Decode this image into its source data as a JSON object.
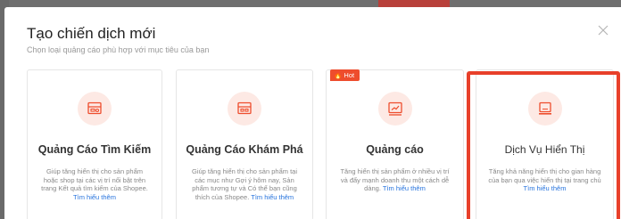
{
  "modal": {
    "title": "Tạo chiến dịch mới",
    "subtitle": "Chọn loại quảng cáo phù hợp với mục tiêu của bạn"
  },
  "cards": [
    {
      "title": "Quảng Cáo Tìm Kiếm",
      "desc": "Giúp tăng hiển thị cho sản phẩm hoặc shop tại các vị trí nổi bật trên trang Kết quả tìm kiếm của Shopee.",
      "learn": "Tìm hiểu thêm",
      "icon": "search-ad-icon"
    },
    {
      "title": "Quảng Cáo Khám Phá",
      "desc": "Giúp tăng hiển thị cho sản phẩm tại các mục như Gợi ý hôm nay, Sản phẩm tương tự và Có thể bạn cũng thích của Shopee.",
      "learn": "Tìm hiểu thêm",
      "icon": "discovery-ad-icon"
    },
    {
      "title": "Quảng cáo",
      "desc": "Tăng hiển thị sản phẩm ở nhiều vị trí và đẩy mạnh doanh thu một cách dễ dàng.",
      "learn": "Tìm hiểu thêm",
      "icon": "chart-ad-icon",
      "badge": "🔥 Hot"
    },
    {
      "title": "Dịch Vụ Hiển Thị",
      "desc": "Tăng khả năng hiển thị cho gian hàng của bạn qua việc hiển thị tại trang chủ",
      "learn": "Tìm hiểu thêm",
      "icon": "display-service-icon"
    }
  ],
  "colors": {
    "accent": "#ee4d2d",
    "highlight": "#e8402a",
    "link": "#2673dd"
  }
}
